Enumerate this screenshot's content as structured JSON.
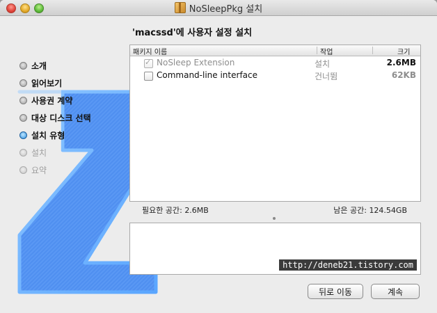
{
  "window": {
    "title": "NoSleepPkg 설치"
  },
  "heading": "'macssd'에 사용자 설정 설치",
  "steps": [
    {
      "label": "소개",
      "state": "done"
    },
    {
      "label": "읽어보기",
      "state": "done"
    },
    {
      "label": "사용권 계약",
      "state": "done"
    },
    {
      "label": "대상 디스크 선택",
      "state": "done"
    },
    {
      "label": "설치 유형",
      "state": "active"
    },
    {
      "label": "설치",
      "state": "pending"
    },
    {
      "label": "요약",
      "state": "pending"
    }
  ],
  "table": {
    "headers": {
      "name": "패키지 이름",
      "action": "작업",
      "size": "크기"
    },
    "rows": [
      {
        "name": "NoSleep Extension",
        "action": "설치",
        "size": "2.6MB",
        "checked": true,
        "disabled": true
      },
      {
        "name": "Command-line interface",
        "action": "건너뜀",
        "size": "62KB",
        "checked": false,
        "disabled": false
      }
    ]
  },
  "space": {
    "required_label": "필요한 공간:",
    "required_value": "2.6MB",
    "remaining_label": "남은 공간:",
    "remaining_value": "124.54GB"
  },
  "watermark": "http://deneb21.tistory.com",
  "buttons": {
    "back": "뒤로 이동",
    "continue": "계속"
  },
  "colors": {
    "accent": "#2c8fe0",
    "installer_logo": "#4a86e8"
  }
}
